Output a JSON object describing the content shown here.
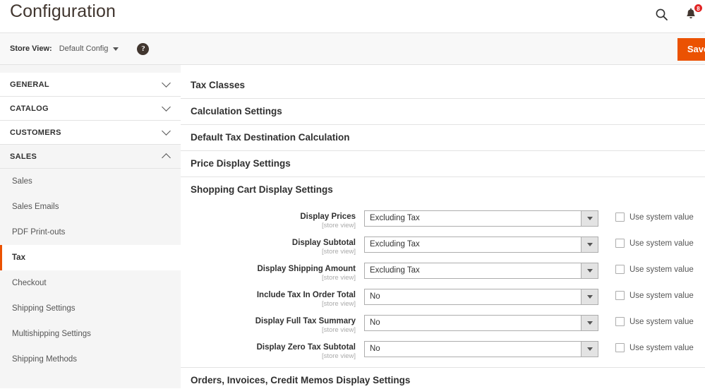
{
  "header": {
    "title": "Configuration",
    "search_icon": "search-icon",
    "notifications_icon": "bell-icon",
    "notifications_count": "8"
  },
  "storeview": {
    "label": "Store View:",
    "selected": "Default Config",
    "help_icon": "question-mark-icon",
    "save_label": "Save Config"
  },
  "sidebar": {
    "sections": [
      {
        "label": "GENERAL",
        "expanded": false,
        "chevron": "chevron-down-icon",
        "children": []
      },
      {
        "label": "CATALOG",
        "expanded": false,
        "chevron": "chevron-down-icon",
        "children": []
      },
      {
        "label": "CUSTOMERS",
        "expanded": false,
        "chevron": "chevron-down-icon",
        "children": []
      },
      {
        "label": "SALES",
        "expanded": true,
        "chevron": "chevron-up-icon",
        "children": [
          {
            "label": "Sales",
            "active": false
          },
          {
            "label": "Sales Emails",
            "active": false
          },
          {
            "label": "PDF Print-outs",
            "active": false
          },
          {
            "label": "Tax",
            "active": true
          },
          {
            "label": "Checkout",
            "active": false
          },
          {
            "label": "Shipping Settings",
            "active": false
          },
          {
            "label": "Multishipping Settings",
            "active": false
          },
          {
            "label": "Shipping Methods",
            "active": false
          }
        ]
      }
    ]
  },
  "main": {
    "sections": [
      {
        "label": "Tax Classes",
        "open": false
      },
      {
        "label": "Calculation Settings",
        "open": false
      },
      {
        "label": "Default Tax Destination Calculation",
        "open": false
      },
      {
        "label": "Price Display Settings",
        "open": false
      },
      {
        "label": "Shopping Cart Display Settings",
        "open": true
      }
    ],
    "bottom_section": {
      "label": "Orders, Invoices, Credit Memos Display Settings"
    },
    "scope_note": "[store view]",
    "system_value_label": "Use system value",
    "fields": [
      {
        "label": "Display Prices",
        "scope": "[store view]",
        "value": "Excluding Tax",
        "use_system": false
      },
      {
        "label": "Display Subtotal",
        "scope": "[store view]",
        "value": "Excluding Tax",
        "use_system": false
      },
      {
        "label": "Display Shipping Amount",
        "scope": "[store view]",
        "value": "Excluding Tax",
        "use_system": false
      },
      {
        "label": "Include Tax In Order Total",
        "scope": "[store view]",
        "value": "No",
        "use_system": false
      },
      {
        "label": "Display Full Tax Summary",
        "scope": "[store view]",
        "value": "No",
        "use_system": false
      },
      {
        "label": "Display Zero Tax Subtotal",
        "scope": "[store view]",
        "value": "No",
        "use_system": false
      }
    ]
  },
  "colors": {
    "accent": "#eb5202",
    "badge": "#e22626",
    "text": "#303030",
    "muted": "#aaaaaa",
    "border": "#e3e3e3",
    "panel": "#f5f5f5"
  }
}
